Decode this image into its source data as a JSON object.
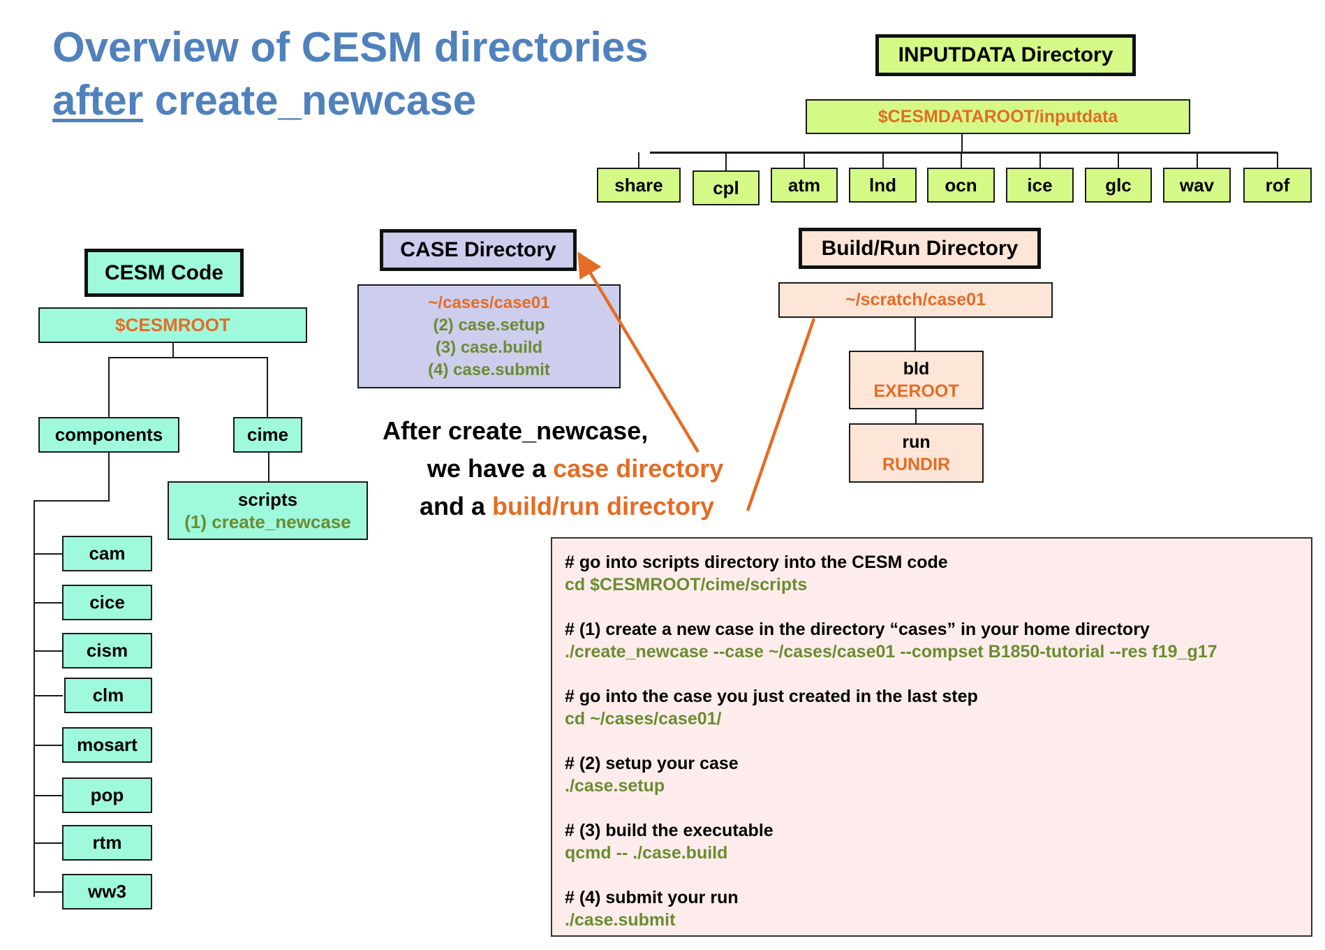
{
  "title": {
    "line1": "Overview of CESM directories",
    "line2_underlined": "after",
    "line2_rest": " create_newcase"
  },
  "colors": {
    "title_blue": "#4f81bd",
    "path_orange": "#e46c24",
    "command_green": "#6a8c30",
    "cesm_code_fill": "#9ff9dc",
    "inputdata_fill": "#d5f986",
    "case_fill": "#cdcdee",
    "buildrun_fill": "#fde6d8",
    "commands_fill": "#fdeceb"
  },
  "inputdata": {
    "header": "INPUTDATA Directory",
    "root": "$CESMDATAROOT/inputdata",
    "children": [
      "share",
      "cpl",
      "atm",
      "lnd",
      "ocn",
      "ice",
      "glc",
      "wav",
      "rof"
    ]
  },
  "cesm_code": {
    "header": "CESM Code",
    "root": "$CESMROOT",
    "components_label": "components",
    "cime_label": "cime",
    "scripts_label": "scripts",
    "scripts_step": "(1) create_newcase",
    "components": [
      "cam",
      "cice",
      "cism",
      "clm",
      "mosart",
      "pop",
      "rtm",
      "ww3"
    ]
  },
  "case_dir": {
    "header": "CASE Directory",
    "path": "~/cases/case01",
    "steps": [
      "(2) case.setup",
      "(3) case.build",
      "(4) case.submit"
    ]
  },
  "buildrun_dir": {
    "header": "Build/Run Directory",
    "path": "~/scratch/case01",
    "bld_label": "bld",
    "bld_var": "EXEROOT",
    "run_label": "run",
    "run_var": "RUNDIR"
  },
  "summary": {
    "line1": "After create_newcase,",
    "line2_prefix": "we have a ",
    "line2_highlight": "case directory",
    "line3_prefix": "and a ",
    "line3_highlight": "build/run directory"
  },
  "commands": [
    {
      "comment": "# go into scripts directory into the CESM code",
      "command": "cd $CESMROOT/cime/scripts"
    },
    {
      "comment": "# (1) create a new case in the directory “cases” in your home directory",
      "command": "./create_newcase --case ~/cases/case01 --compset B1850-tutorial --res f19_g17"
    },
    {
      "comment": "# go into the case you just created in the last step",
      "command": "cd ~/cases/case01/"
    },
    {
      "comment": "# (2) setup your case",
      "command": "./case.setup"
    },
    {
      "comment": "# (3) build the executable",
      "command": "qcmd -- ./case.build"
    },
    {
      "comment": "# (4) submit your run",
      "command": "./case.submit"
    }
  ]
}
